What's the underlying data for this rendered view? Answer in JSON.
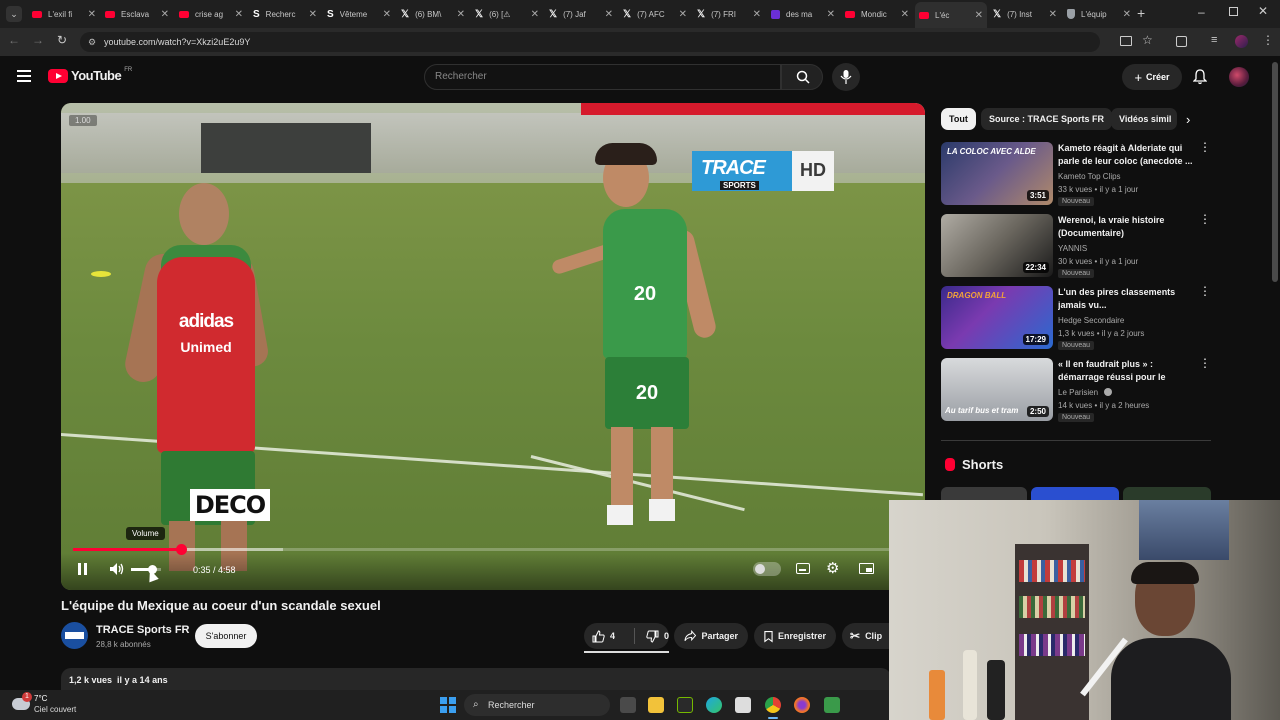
{
  "browser": {
    "tabs": [
      {
        "label": "L'exil fi",
        "icon": "youtube-icon"
      },
      {
        "label": "Esclava",
        "icon": "youtube-icon"
      },
      {
        "label": "crise ag",
        "icon": "youtube-icon"
      },
      {
        "label": "Recherc",
        "icon": "s-icon"
      },
      {
        "label": "Vêteme",
        "icon": "s-icon"
      },
      {
        "label": "(6) BM\\",
        "icon": "x-icon"
      },
      {
        "label": "(6) [⚠",
        "icon": "x-icon"
      },
      {
        "label": "(7) Jaf",
        "icon": "x-icon"
      },
      {
        "label": "(7) AFC",
        "icon": "x-icon"
      },
      {
        "label": "(7) FRI",
        "icon": "x-icon"
      },
      {
        "label": "des ma",
        "icon": "yahoo-icon"
      },
      {
        "label": "Mondic",
        "icon": "youtube-icon"
      },
      {
        "label": "L'éc",
        "icon": "youtube-icon"
      },
      {
        "label": "(7) Inst",
        "icon": "x-icon"
      },
      {
        "label": "L'équip",
        "icon": "shield-icon"
      }
    ],
    "url": "youtube.com/watch?v=Xkzi2uE2u9Y"
  },
  "header": {
    "logo_text": "YouTube",
    "region": "FR",
    "search_placeholder": "Rechercher",
    "create_label": "Créer"
  },
  "video": {
    "speed_label": "1.00",
    "deco_text": "DECO",
    "logo_top": "TRACE",
    "logo_sub": "SPORTS",
    "logo_hd": "HD",
    "jersey_brand": "adidas",
    "jersey_sponsor": "Unimed",
    "jersey_number": "20",
    "volume_tooltip": "Volume",
    "time_current": "0:35",
    "time_sep": " / ",
    "time_total": "4:58",
    "progress_played": 0.129,
    "progress_buffered": 0.25,
    "volume_level": 0.7
  },
  "watch": {
    "title": "L'équipe du Mexique au coeur d'un scandale sexuel",
    "channel_name": "TRACE Sports FR",
    "subscribers": "28,8 k abonnés",
    "subscribe_label": "S'abonner",
    "likes": "4",
    "dislikes": "0",
    "share_label": "Partager",
    "save_label": "Enregistrer",
    "clip_label": "Clip",
    "views": "1,2 k vues",
    "uploaded": "il y a 14 ans"
  },
  "sidebar": {
    "chips": [
      {
        "label": "Tout",
        "active": true
      },
      {
        "label": "Source : TRACE Sports FR",
        "active": false
      },
      {
        "label": "Vidéos simil",
        "active": false
      }
    ],
    "recommendations": [
      {
        "title": "Kameto réagit à Alderiate qui parle de leur coloc (anecdote ...",
        "channel": "Kameto Top Clips",
        "meta": "33 k vues • il y a 1 jour",
        "badge": "Nouveau",
        "duration": "3:51",
        "thumb_text": "LA COLOC AVEC ALDE",
        "verified": false
      },
      {
        "title": "Werenoi, la vraie histoire (Documentaire)",
        "channel": "YANNIS",
        "meta": "30 k vues • il y a 1 jour",
        "badge": "Nouveau",
        "duration": "22:34",
        "thumb_text": "",
        "verified": false
      },
      {
        "title": "L'un des pires classements jamais vu...",
        "channel": "Hedge Secondaire",
        "meta": "1,3 k vues • il y a 2 jours",
        "badge": "Nouveau",
        "duration": "17:29",
        "thumb_text": "DRAGON BALL",
        "verified": false
      },
      {
        "title": "« Il en faudrait plus » : démarrage réussi pour le Câbl...",
        "channel": "Le Parisien",
        "meta": "14 k vues • il y a 2 heures",
        "badge": "Nouveau",
        "duration": "2:50",
        "thumb_text": "Au tarif bus et tram",
        "verified": true
      }
    ],
    "shorts_label": "Shorts"
  },
  "taskbar": {
    "weather_temp": "7°C",
    "weather_desc": "Ciel couvert",
    "search_label": "Rechercher",
    "notif_count": "1"
  },
  "colors": {
    "brand_red": "#ff0033",
    "background": "#0f0f0f",
    "surface": "#272727"
  }
}
